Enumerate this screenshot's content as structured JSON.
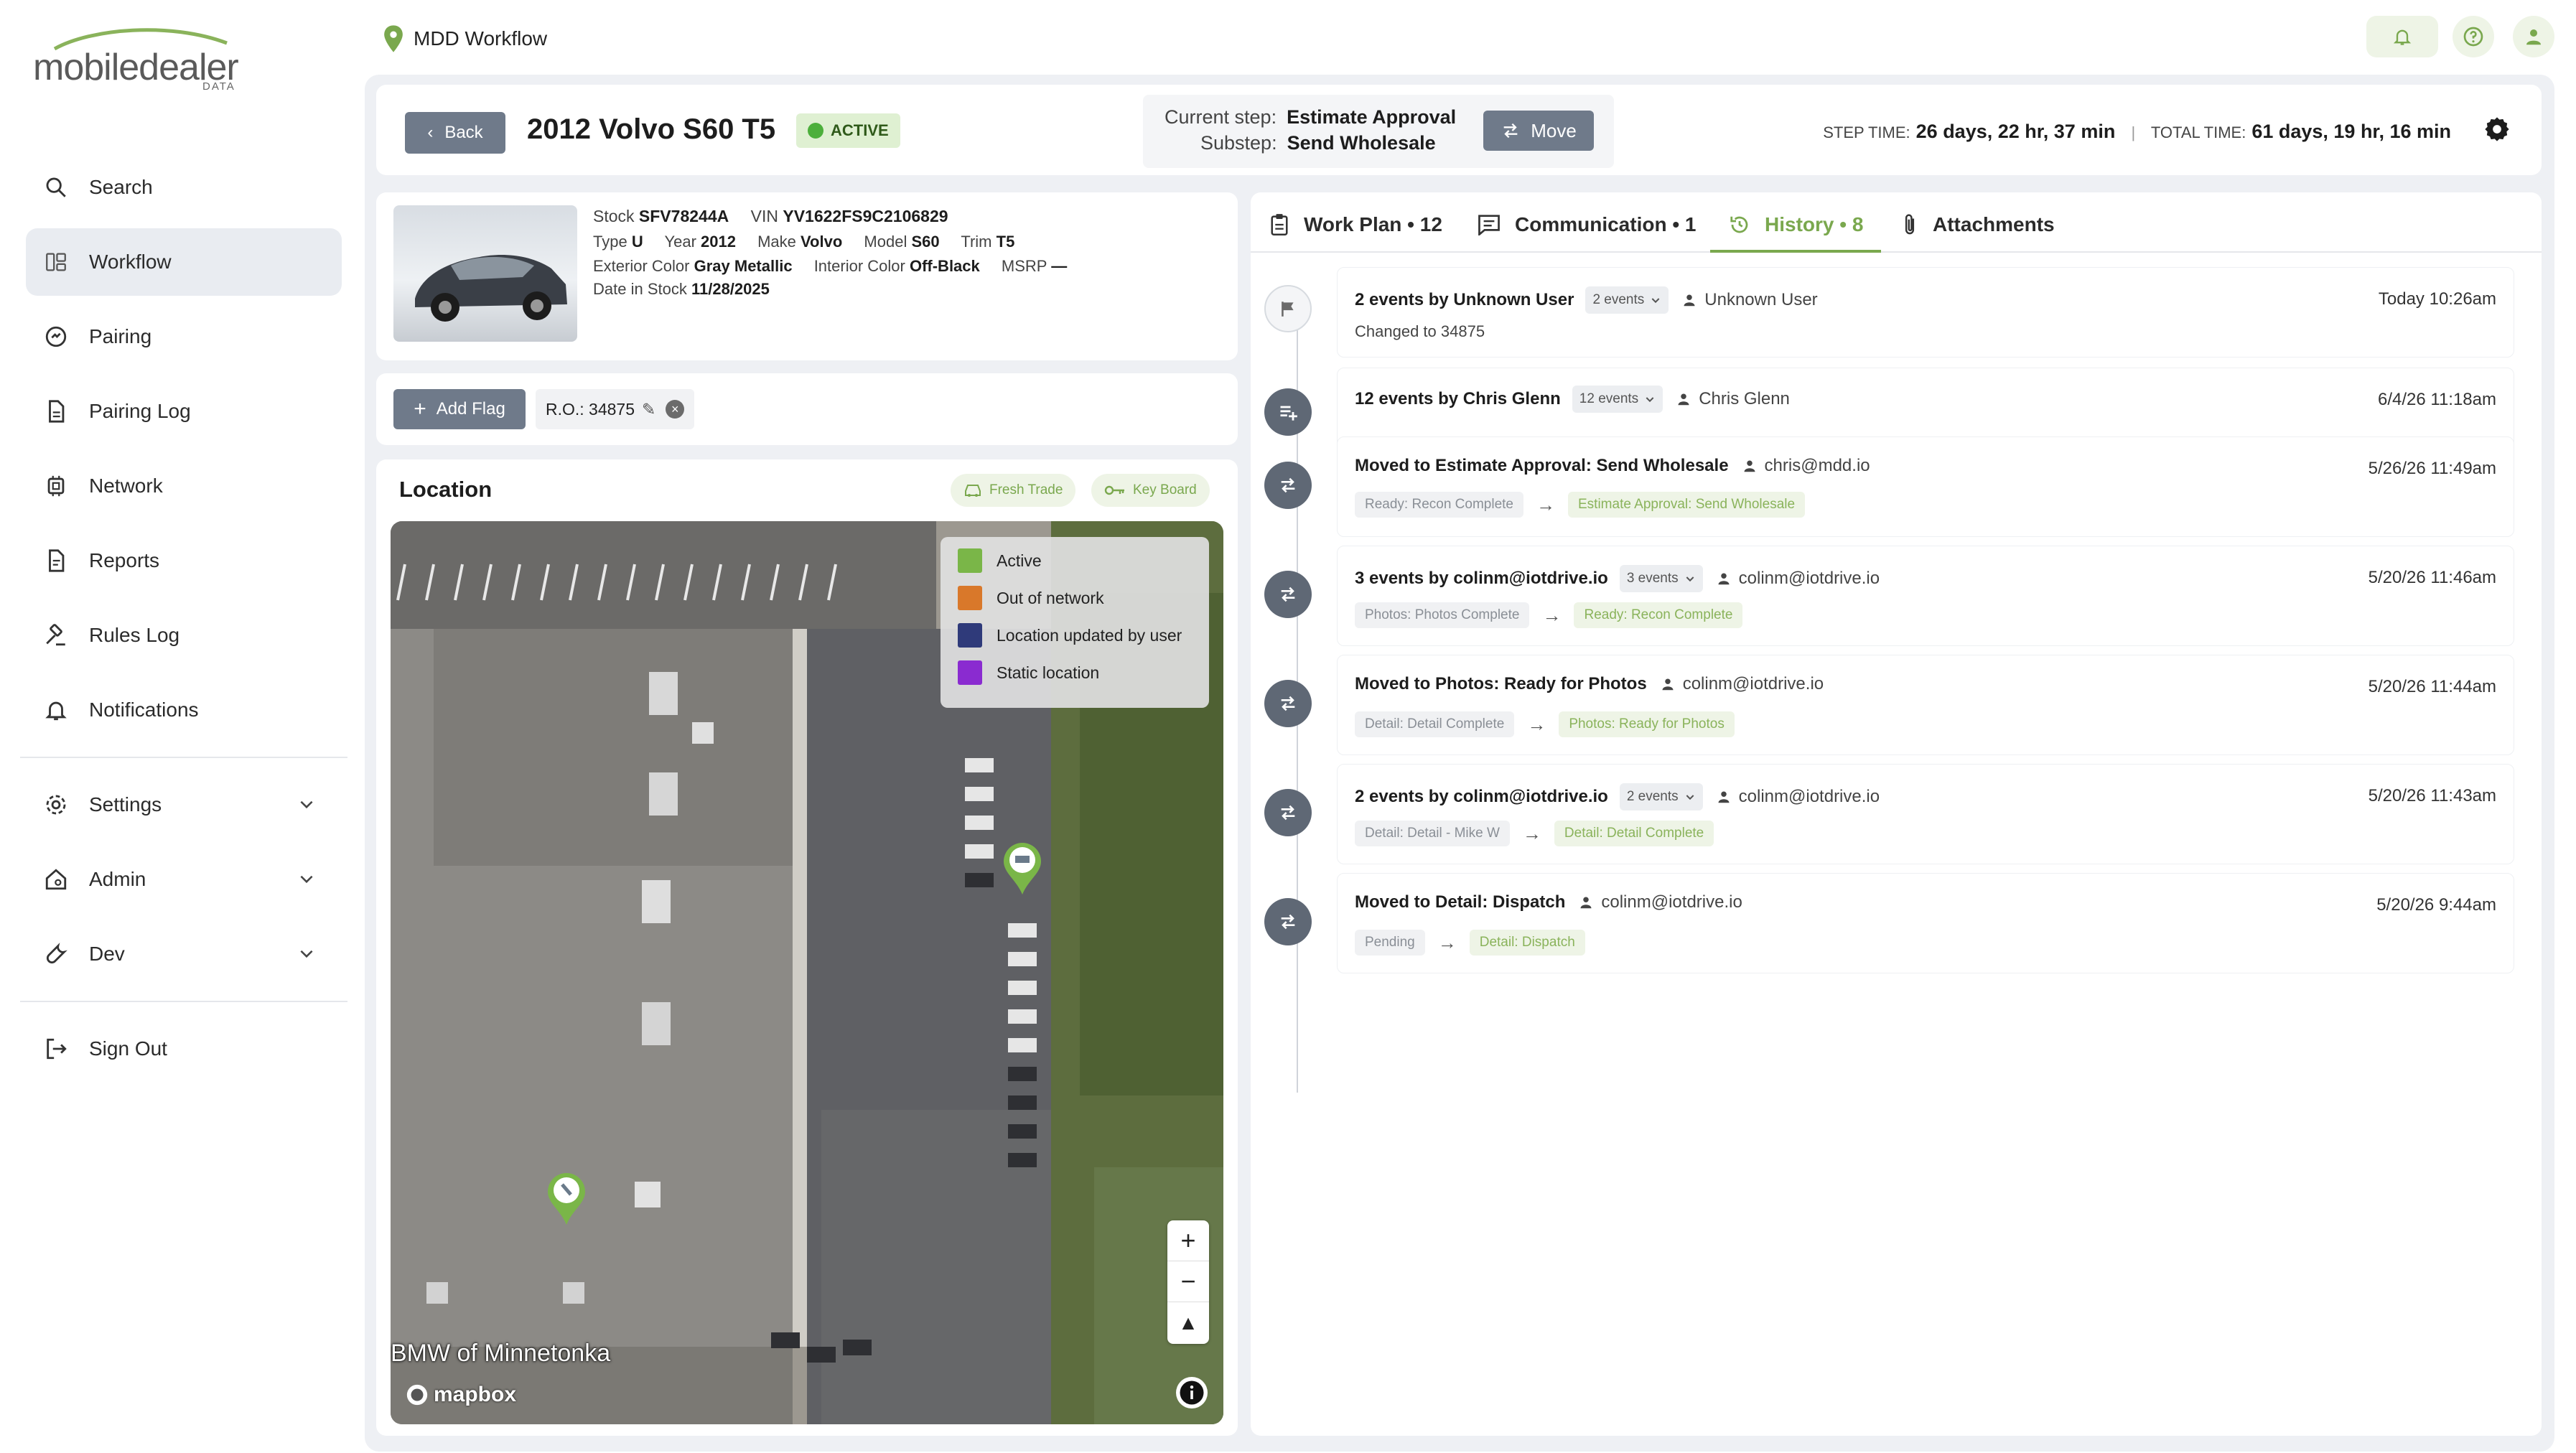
{
  "app": {
    "logo_main": "mobiledealer",
    "logo_sub": "DATA",
    "page_title": "MDD Workflow",
    "accent_color": "#7aa84e",
    "button_color": "#6f7a8a"
  },
  "sidebar": {
    "items": [
      {
        "label": "Search",
        "icon": "search-icon"
      },
      {
        "label": "Workflow",
        "icon": "workflow-icon",
        "active": true
      },
      {
        "label": "Pairing",
        "icon": "pairing-icon"
      },
      {
        "label": "Pairing Log",
        "icon": "document-icon"
      },
      {
        "label": "Network",
        "icon": "network-icon"
      },
      {
        "label": "Reports",
        "icon": "report-icon"
      },
      {
        "label": "Rules Log",
        "icon": "gavel-icon"
      },
      {
        "label": "Notifications",
        "icon": "bell-icon"
      }
    ],
    "groups": [
      {
        "label": "Settings",
        "icon": "gear-icon"
      },
      {
        "label": "Admin",
        "icon": "home-gear-icon"
      },
      {
        "label": "Dev",
        "icon": "wrench-icon"
      }
    ],
    "sign_out": "Sign Out"
  },
  "header": {
    "back_label": "Back",
    "vehicle_title": "2012 Volvo S60 T5",
    "status": "ACTIVE",
    "current_step_label": "Current step:",
    "current_step_value": "Estimate Approval",
    "substep_label": "Substep:",
    "substep_value": "Send Wholesale",
    "move_label": "Move",
    "step_time_label": "STEP TIME:",
    "step_time_value": "26 days, 22 hr, 37 min",
    "total_time_label": "TOTAL TIME:",
    "total_time_value": "61 days, 19 hr, 16 min"
  },
  "vehicle": {
    "stock_label": "Stock",
    "stock": "SFV78244A",
    "vin_label": "VIN",
    "vin": "YV1622FS9C2106829",
    "type_label": "Type",
    "type": "U",
    "year_label": "Year",
    "year": "2012",
    "make_label": "Make",
    "make": "Volvo",
    "model_label": "Model",
    "model": "S60",
    "trim_label": "Trim",
    "trim": "T5",
    "ext_color_label": "Exterior Color",
    "ext_color": "Gray Metallic",
    "int_color_label": "Interior Color",
    "int_color": "Off-Black",
    "msrp_label": "MSRP",
    "msrp": "—",
    "date_label": "Date in Stock",
    "date": "11/28/2025"
  },
  "flags": {
    "add_label": "Add Flag",
    "ro_label": "R.O.: 34875"
  },
  "location": {
    "title": "Location",
    "chip_fresh_trade": "Fresh Trade",
    "chip_key_board": "Key Board",
    "legend": [
      {
        "label": "Active",
        "color": "#7ab648"
      },
      {
        "label": "Out of network",
        "color": "#d9782a"
      },
      {
        "label": "Location updated by user",
        "color": "#2f3a7a"
      },
      {
        "label": "Static location",
        "color": "#8a2bd0"
      }
    ],
    "map_label": "BMW of Minnetonka",
    "attribution": "mapbox",
    "zoom_in": "+",
    "zoom_out": "−"
  },
  "tabs": [
    {
      "label": "Work Plan • 12",
      "icon": "clipboard-icon"
    },
    {
      "label": "Communication • 1",
      "icon": "chat-icon"
    },
    {
      "label": "History • 8",
      "icon": "history-icon",
      "active": true
    },
    {
      "label": "Attachments",
      "icon": "paperclip-icon"
    }
  ],
  "history": [
    {
      "title": "2 events by Unknown User",
      "count": "2 events",
      "user": "Unknown User",
      "time": "Today 10:26am",
      "sub": "Changed to 34875",
      "icon": "flag-icon"
    },
    {
      "title": "12 events by Chris Glenn",
      "count": "12 events",
      "user": "Chris Glenn",
      "time": "6/4/26 11:18am",
      "icon": "list-add-icon"
    },
    {
      "title": "Moved to Estimate Approval: Send Wholesale",
      "user": "chris@mdd.io",
      "time": "5/26/26 11:49am",
      "from": "Ready: Recon Complete",
      "to": "Estimate Approval: Send Wholesale",
      "icon": "swap-icon"
    },
    {
      "title": "3 events by colinm@iotdrive.io",
      "count": "3 events",
      "user": "colinm@iotdrive.io",
      "time": "5/20/26 11:46am",
      "from": "Photos: Photos Complete",
      "to": "Ready: Recon Complete",
      "icon": "swap-icon"
    },
    {
      "title": "Moved to Photos: Ready for Photos",
      "user": "colinm@iotdrive.io",
      "time": "5/20/26 11:44am",
      "from": "Detail: Detail Complete",
      "to": "Photos: Ready for Photos",
      "icon": "swap-icon"
    },
    {
      "title": "2 events by colinm@iotdrive.io",
      "count": "2 events",
      "user": "colinm@iotdrive.io",
      "time": "5/20/26 11:43am",
      "from": "Detail: Detail - Mike W",
      "to": "Detail: Detail Complete",
      "icon": "swap-icon"
    },
    {
      "title": "Moved to Detail: Dispatch",
      "user": "colinm@iotdrive.io",
      "time": "5/20/26 9:44am",
      "from": "Pending",
      "to": "Detail: Dispatch",
      "icon": "swap-icon"
    }
  ]
}
